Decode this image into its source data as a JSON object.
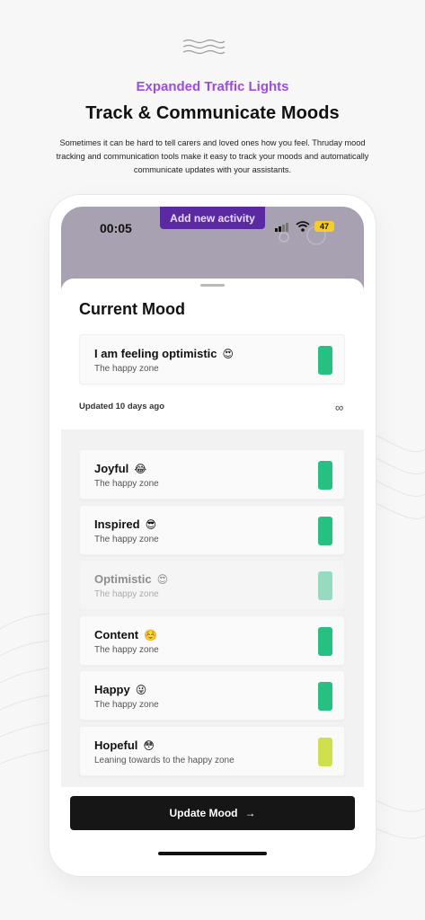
{
  "header": {
    "icon": "wave-lines-icon",
    "eyebrow": "Expanded Traffic Lights",
    "title": "Track & Communicate Moods",
    "description": "Sometimes it can be hard to tell carers and loved ones how you feel. Thruday mood tracking and communication tools make it easy to track your moods and automatically communicate updates with your assistants."
  },
  "status_bar": {
    "time": "00:05",
    "battery": "47",
    "banner": "Add new activity"
  },
  "current_mood": {
    "title": "Current Mood",
    "mood": "I am feeling optimistic",
    "emoji": "😍",
    "zone": "The happy zone",
    "color": "#27c083",
    "updated": "Updated 10 days ago",
    "infinity": "∞"
  },
  "moods": [
    {
      "name": "Joyful",
      "emoji": "😂",
      "zone": "The happy zone",
      "color": "#27c083",
      "faded": false
    },
    {
      "name": "Inspired",
      "emoji": "😎",
      "zone": "The happy zone",
      "color": "#27c083",
      "faded": false
    },
    {
      "name": "Optimistic",
      "emoji": "😍",
      "zone": "The happy zone",
      "color": "#27c083",
      "faded": true
    },
    {
      "name": "Content",
      "emoji": "☺️",
      "zone": "The happy zone",
      "color": "#27c083",
      "faded": false
    },
    {
      "name": "Happy",
      "emoji": "😜",
      "zone": "The happy zone",
      "color": "#27c083",
      "faded": false
    },
    {
      "name": "Hopeful",
      "emoji": "😳",
      "zone": "Leaning towards to the happy zone",
      "color": "#d0e04c",
      "faded": false
    }
  ],
  "actions": {
    "update_label": "Update Mood",
    "update_arrow": "→"
  },
  "colors": {
    "accent": "#9b4de0",
    "banner": "#5b2aa3",
    "green": "#27c083",
    "yellow_green": "#d0e04c"
  }
}
